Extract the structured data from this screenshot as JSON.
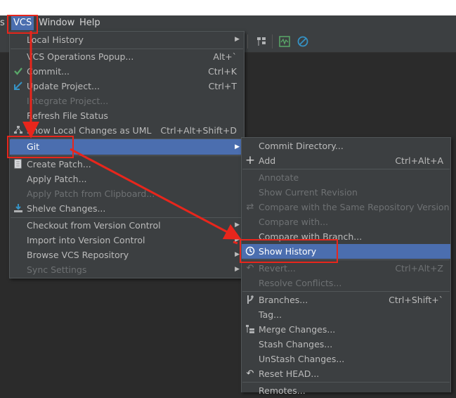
{
  "menubar": {
    "items": [
      {
        "label": "s"
      },
      {
        "label": "VCS"
      },
      {
        "label": "Window"
      },
      {
        "label": "Help"
      }
    ]
  },
  "vcs_menu": {
    "items": [
      {
        "label": "Local History",
        "shortcut": "",
        "submenu": true,
        "icon": "",
        "disabled": false
      },
      {
        "label": "VCS Operations Popup...",
        "shortcut": "Alt+`",
        "submenu": false,
        "icon": "",
        "disabled": false
      },
      {
        "label": "Commit...",
        "shortcut": "Ctrl+K",
        "submenu": false,
        "icon": "check-icon",
        "disabled": false
      },
      {
        "label": "Update Project...",
        "shortcut": "Ctrl+T",
        "submenu": false,
        "icon": "update-arrow-icon",
        "disabled": false
      },
      {
        "label": "Integrate Project...",
        "shortcut": "",
        "submenu": false,
        "icon": "",
        "disabled": true
      },
      {
        "label": "Refresh File Status",
        "shortcut": "",
        "submenu": false,
        "icon": "",
        "disabled": false
      },
      {
        "label": "Show Local Changes as UML",
        "shortcut": "Ctrl+Alt+Shift+D",
        "submenu": false,
        "icon": "uml-icon",
        "disabled": false
      },
      {
        "label": "Git",
        "shortcut": "",
        "submenu": true,
        "icon": "",
        "disabled": false,
        "selected": true
      },
      {
        "label": "Create Patch...",
        "shortcut": "",
        "submenu": false,
        "icon": "patch-icon",
        "disabled": false
      },
      {
        "label": "Apply Patch...",
        "shortcut": "",
        "submenu": false,
        "icon": "",
        "disabled": false
      },
      {
        "label": "Apply Patch from Clipboard...",
        "shortcut": "",
        "submenu": false,
        "icon": "",
        "disabled": true
      },
      {
        "label": "Shelve Changes...",
        "shortcut": "",
        "submenu": false,
        "icon": "shelve-icon",
        "disabled": false
      },
      {
        "label": "Checkout from Version Control",
        "shortcut": "",
        "submenu": true,
        "icon": "",
        "disabled": false
      },
      {
        "label": "Import into Version Control",
        "shortcut": "",
        "submenu": true,
        "icon": "",
        "disabled": false
      },
      {
        "label": "Browse VCS Repository",
        "shortcut": "",
        "submenu": true,
        "icon": "",
        "disabled": false
      },
      {
        "label": "Sync Settings",
        "shortcut": "",
        "submenu": true,
        "icon": "",
        "disabled": true
      }
    ]
  },
  "git_menu": {
    "items": [
      {
        "label": "Commit Directory...",
        "shortcut": "",
        "icon": "",
        "disabled": false
      },
      {
        "label": "Add",
        "shortcut": "Ctrl+Alt+A",
        "icon": "plus-icon",
        "disabled": false
      },
      {
        "label": "Annotate",
        "shortcut": "",
        "icon": "",
        "disabled": true
      },
      {
        "label": "Show Current Revision",
        "shortcut": "",
        "icon": "",
        "disabled": true
      },
      {
        "label": "Compare with the Same Repository Version",
        "shortcut": "",
        "icon": "compare-icon",
        "disabled": true
      },
      {
        "label": "Compare with...",
        "shortcut": "",
        "icon": "",
        "disabled": true
      },
      {
        "label": "Compare with Branch...",
        "shortcut": "",
        "icon": "",
        "disabled": false
      },
      {
        "label": "Show History",
        "shortcut": "",
        "icon": "clock-icon",
        "disabled": false,
        "selected": true
      },
      {
        "label": "Revert...",
        "shortcut": "Ctrl+Alt+Z",
        "icon": "revert-icon",
        "disabled": true
      },
      {
        "label": "Resolve Conflicts...",
        "shortcut": "",
        "icon": "",
        "disabled": true
      },
      {
        "label": "Branches...",
        "shortcut": "Ctrl+Shift+`",
        "icon": "branch-icon",
        "disabled": false
      },
      {
        "label": "Tag...",
        "shortcut": "",
        "icon": "",
        "disabled": false
      },
      {
        "label": "Merge Changes...",
        "shortcut": "",
        "icon": "merge-icon",
        "disabled": false
      },
      {
        "label": "Stash Changes...",
        "shortcut": "",
        "icon": "",
        "disabled": false
      },
      {
        "label": "UnStash Changes...",
        "shortcut": "",
        "icon": "",
        "disabled": false
      },
      {
        "label": "Reset HEAD...",
        "shortcut": "",
        "icon": "reset-icon",
        "disabled": false
      },
      {
        "label": "Remotes...",
        "shortcut": "",
        "icon": "",
        "disabled": false
      }
    ]
  },
  "colors": {
    "menu_bg": "#3c3f41",
    "selection": "#4b6eaf",
    "annotation_red": "#e8261c",
    "check_green": "#59a869",
    "update_blue": "#3592c4"
  }
}
